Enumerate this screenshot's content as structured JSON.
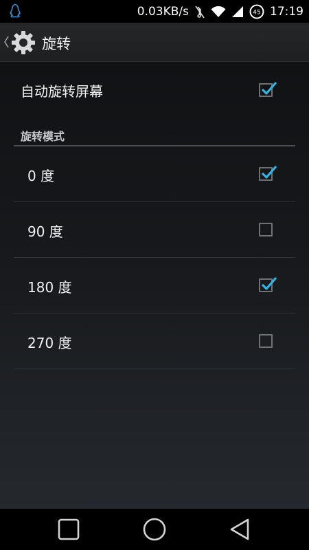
{
  "status_bar": {
    "network_speed": "0.03KB/s",
    "battery_level": "45",
    "time": "17:19",
    "icons": [
      "qq-penguin-icon",
      "mute-icon",
      "wifi-icon",
      "signal-icon",
      "battery-icon"
    ]
  },
  "action_bar": {
    "title": "旋转",
    "icon": "settings-gear-icon"
  },
  "auto_rotate": {
    "label": "自动旋转屏幕",
    "checked": true
  },
  "rotation_mode": {
    "category_title": "旋转模式",
    "options": [
      {
        "label": "0 度",
        "checked": true
      },
      {
        "label": "90 度",
        "checked": false
      },
      {
        "label": "180 度",
        "checked": true
      },
      {
        "label": "270 度",
        "checked": false
      }
    ]
  },
  "nav_bar": {
    "buttons": [
      "recents-icon",
      "home-icon",
      "back-icon"
    ]
  },
  "colors": {
    "accent": "#33b5e5",
    "checkbox_border": "#6f7377",
    "action_bar": "#232527"
  }
}
